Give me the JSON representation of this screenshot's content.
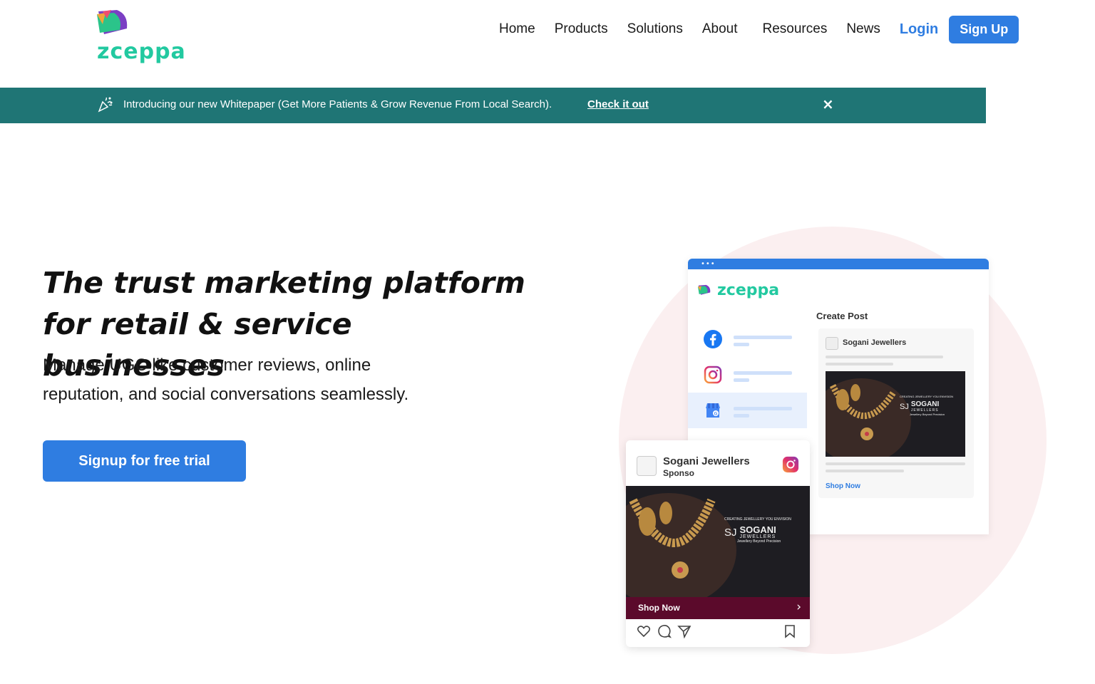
{
  "header": {
    "logo_text": "zceppa",
    "nav": [
      "Home",
      "Products",
      "Solutions",
      "About",
      "Resources",
      "News"
    ],
    "login_label": "Login",
    "signup_label": "Sign Up"
  },
  "banner": {
    "text": "Introducing our new Whitepaper (Get More Patients & Grow Revenue From Local Search).",
    "link": "Check it out",
    "close": "×"
  },
  "hero": {
    "title_line1": "The trust marketing platform",
    "title_line2": "for retail & service businesses",
    "subtitle_line1": "Manage UGC like customer reviews, online",
    "subtitle_line2": "reputation, and social conversations seamlessly.",
    "cta_label": "Signup for free trial"
  },
  "illustration": {
    "window_dots": "•••",
    "app_logo": "zceppa",
    "create_post": "Create Post",
    "post_card": {
      "name": "Sogani Jewellers",
      "shop_now": "Shop Now",
      "brand_tagline": "CREATING JEWELLERY YOU ENVISION",
      "brand_mark": "SJ",
      "brand_name": "SOGANI",
      "brand_sub": "JEWELLERS",
      "brand_slogan": "Jewellery Beyond Precision"
    },
    "ig_card": {
      "name": "Sogani Jewellers",
      "sponsored": "Sponso",
      "shop_now": "Shop Now",
      "arrow": "›",
      "brand_tagline": "CREATING JEWELLERY YOU ENVISION",
      "brand_mark": "SJ",
      "brand_name": "SOGANI",
      "brand_sub": "JEWELLERS",
      "brand_slogan": "Jewellery Beyond Precision"
    }
  },
  "colors": {
    "accent": "#2f7de1",
    "brand_green": "#22c9a0",
    "banner": "#1f7575",
    "ig_bar": "#5b0a2b"
  }
}
